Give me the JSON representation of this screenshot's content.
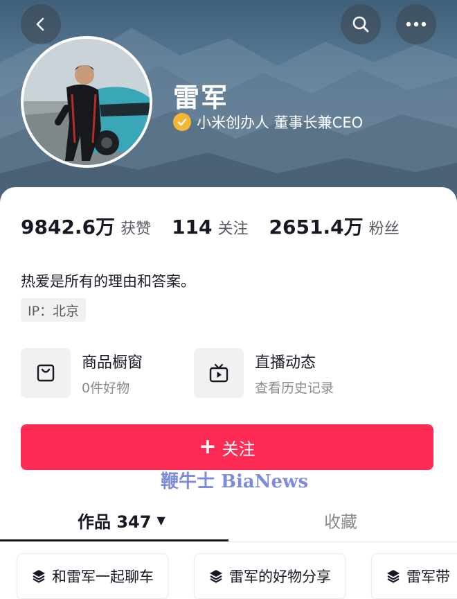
{
  "header": {
    "name": "雷军",
    "verification": "小米创办人 董事长兼CEO"
  },
  "stats": [
    {
      "value": "9842.6万",
      "label": "获赞"
    },
    {
      "value": "114",
      "label": "关注"
    },
    {
      "value": "2651.4万",
      "label": "粉丝"
    }
  ],
  "bio": "热爱是所有的理由和答案。",
  "ip_location": "IP：北京",
  "features": {
    "shop": {
      "title": "商品橱窗",
      "subtitle": "0件好物",
      "icon": "shopping-bag-icon"
    },
    "live": {
      "title": "直播动态",
      "subtitle": "查看历史记录",
      "icon": "tv-icon"
    }
  },
  "follow_button": {
    "plus": "+",
    "label": "关注"
  },
  "watermark": "鞭牛士 BiaNews",
  "tabs": {
    "works": "作品 347",
    "works_caret": "▼",
    "collections": "收藏"
  },
  "collections": [
    {
      "label": "和雷军一起聊车",
      "icon": "stack-icon"
    },
    {
      "label": "雷军的好物分享",
      "icon": "stack-icon"
    },
    {
      "label": "雷军带",
      "icon": "stack-icon"
    }
  ],
  "colors": {
    "follow": "#fe2c55",
    "verify_badge": "#f5b733"
  }
}
